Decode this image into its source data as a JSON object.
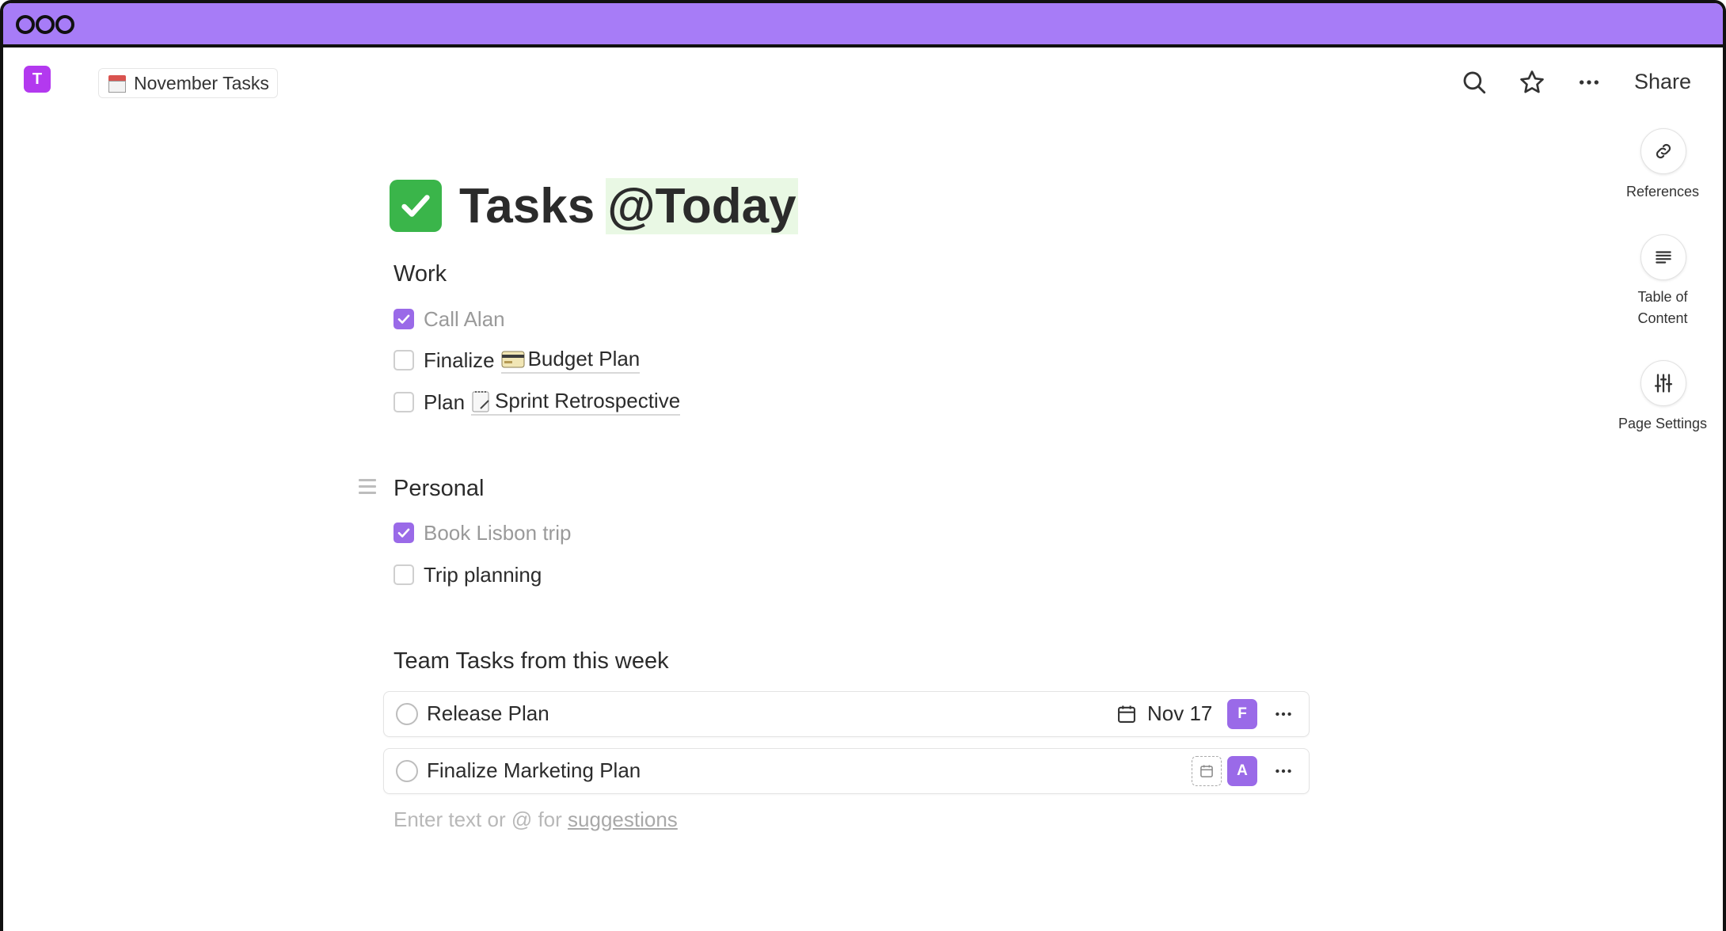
{
  "breadcrumb": {
    "label": "November Tasks",
    "icon": "calendar-icon"
  },
  "workspace": {
    "initial": "T",
    "color": "#b339ef"
  },
  "topbar": {
    "share_label": "Share"
  },
  "side_panel": {
    "items": [
      {
        "label": "References",
        "icon": "link-icon"
      },
      {
        "label": "Table of Content",
        "icon": "align-left-icon"
      },
      {
        "label": "Page Settings",
        "icon": "sliders-icon"
      }
    ]
  },
  "page": {
    "title_prefix": "Tasks",
    "title_mention": "@Today",
    "title_icon": "check-mark-emoji"
  },
  "sections": {
    "work": {
      "heading": "Work",
      "tasks": [
        {
          "label": "Call Alan",
          "checked": true
        },
        {
          "label": "Finalize",
          "link": "Budget Plan",
          "link_icon": "credit-card-emoji",
          "checked": false
        },
        {
          "label": "Plan",
          "link": "Sprint Retrospective",
          "link_icon": "notepad-emoji",
          "checked": false
        }
      ]
    },
    "personal": {
      "heading": "Personal",
      "tasks": [
        {
          "label": "Book Lisbon trip",
          "checked": true
        },
        {
          "label": "Trip planning",
          "checked": false
        }
      ]
    },
    "team": {
      "heading": "Team Tasks from this week",
      "rows": [
        {
          "label": "Release Plan",
          "date": "Nov 17",
          "assignee": "F"
        },
        {
          "label": "Finalize Marketing Plan",
          "date": "",
          "assignee": "A"
        }
      ]
    }
  },
  "editor": {
    "placeholder": "Enter text or @ for",
    "placeholder_link": "suggestions"
  },
  "colors": {
    "accent": "#9a6ae8",
    "titlebar": "#a77cf7",
    "mention_bg": "#e9f8e4"
  }
}
